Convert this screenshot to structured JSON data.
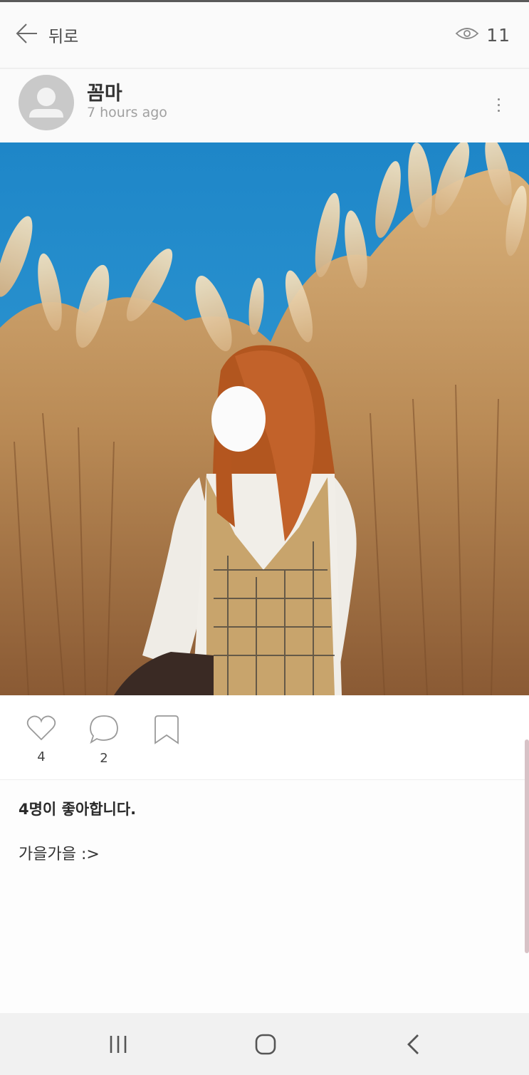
{
  "header": {
    "back_label": "뒤로",
    "view_count": "11",
    "icons": [
      "back-arrow-icon",
      "eye-icon"
    ]
  },
  "post": {
    "author_name": "꼼마",
    "time_ago": "7 hours ago",
    "icons": [
      "avatar-placeholder-icon",
      "more-vertical-icon"
    ],
    "photo": "photo of a person with auburn hair in a white blouse and houndstooth vest standing in tall silver grass under a blue sky; face obscured"
  },
  "actions": {
    "like_count": "4",
    "comment_count": "2",
    "icons": [
      "heart-icon",
      "comment-bubble-icon",
      "bookmark-icon"
    ]
  },
  "summary": {
    "likes_text": "4명이 좋아합니다.",
    "caption": "가을가을 :>"
  },
  "navbar": {
    "icons": [
      "recent-apps-icon",
      "home-icon",
      "back-icon"
    ]
  },
  "colors": {
    "sky": "#2f90cc",
    "grass": "#c99b62",
    "topbar_bg": "#fafafa",
    "navbar_bg": "#f1f1f1"
  }
}
